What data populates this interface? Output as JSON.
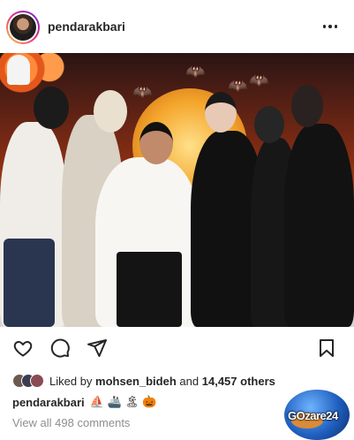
{
  "post": {
    "username": "pendarakbari"
  },
  "likes": {
    "prefix": "Liked by",
    "liker": "mohsen_bideh",
    "connector": "and",
    "count": "14,457 others"
  },
  "caption": {
    "username": "pendarakbari",
    "emojis": "⛵ 🚢 🏝 🎃"
  },
  "comments": {
    "label": "View all 498 comments"
  },
  "watermark": {
    "text": "GOzare24"
  },
  "icons": {
    "more": "more-options-icon",
    "like": "heart-icon",
    "comment": "comment-icon",
    "share": "send-icon",
    "save": "bookmark-icon"
  },
  "colors": {
    "text": "#262626",
    "muted": "#8e8e8e",
    "story_ring_start": "#f9ce34",
    "story_ring_end": "#6228d7"
  }
}
